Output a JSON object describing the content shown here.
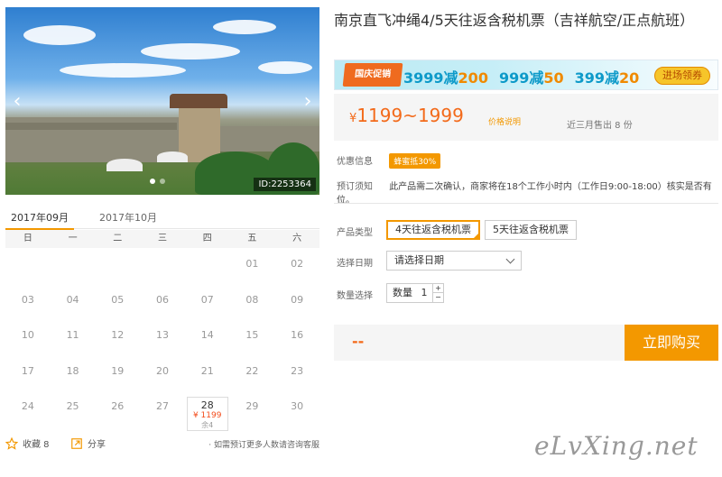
{
  "photo": {
    "id_label": "ID:2253364"
  },
  "calendar": {
    "tabs": [
      {
        "label": "2017年09月"
      },
      {
        "label": "2017年10月"
      }
    ],
    "weekdays": [
      "日",
      "一",
      "二",
      "三",
      "四",
      "五",
      "六"
    ],
    "rows": [
      [
        "",
        "",
        "",
        "",
        "",
        "01",
        "02"
      ],
      [
        "03",
        "04",
        "05",
        "06",
        "07",
        "08",
        "09"
      ],
      [
        "10",
        "11",
        "12",
        "13",
        "14",
        "15",
        "16"
      ],
      [
        "17",
        "18",
        "19",
        "20",
        "21",
        "22",
        "23"
      ],
      [
        "24",
        "25",
        "26",
        "27",
        "28",
        "29",
        "30"
      ]
    ],
    "available": {
      "day": "28",
      "price": "¥ 1199",
      "left": "余4"
    }
  },
  "footer": {
    "fav_label": "收藏 8",
    "share_label": "分享",
    "note": "· 如需预订更多人数请咨询客服"
  },
  "product": {
    "title": "南京直飞冲绳4/5天往返含税机票（吉祥航空/正点航班）"
  },
  "promo": {
    "tag": "国庆促销",
    "deals": [
      {
        "base": "3999减",
        "off": "200"
      },
      {
        "base": "999减",
        "off": "50"
      },
      {
        "base": "399减",
        "off": "20"
      }
    ],
    "button": "进场领券"
  },
  "price": {
    "currency": "¥",
    "range": "1199~1999",
    "note": "价格说明",
    "sold": "近三月售出 8 份"
  },
  "info": {
    "discount_label": "优惠信息",
    "discount_badge": "蜂蜜抵30%",
    "booking_label": "预订须知",
    "booking_text": "此产品需二次确认，商家将在18个工作小时内（工作日9:00-18:00）核实是否有位。"
  },
  "options": {
    "type_label": "产品类型",
    "types": [
      "4天往返含税机票",
      "5天往返含税机票"
    ],
    "date_label": "选择日期",
    "date_placeholder": "请选择日期",
    "qty_label": "数量选择",
    "qty_text": "数量",
    "qty_value": "1"
  },
  "buy": {
    "total": "--",
    "button": "立即购买"
  },
  "watermark": "eLvXing.net"
}
